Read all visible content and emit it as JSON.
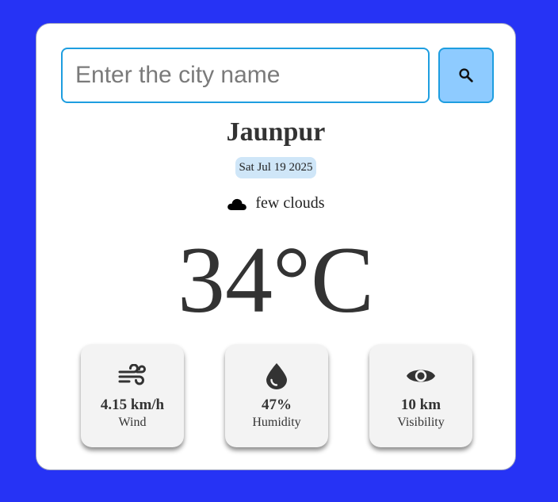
{
  "search": {
    "placeholder": "Enter the city name",
    "value": "",
    "button_icon": "search-icon"
  },
  "weather": {
    "city": "Jaunpur",
    "date": "Sat Jul 19 2025",
    "condition_icon": "cloud-icon",
    "condition": "few clouds",
    "temperature": "34°C"
  },
  "stats": [
    {
      "icon": "wind-icon",
      "value": "4.15 km/h",
      "label": "Wind"
    },
    {
      "icon": "humidity-icon",
      "value": "47%",
      "label": "Humidity"
    },
    {
      "icon": "eye-icon",
      "value": "10 km",
      "label": "Visibility"
    }
  ],
  "colors": {
    "background": "#2633f5",
    "card": "#ffffff",
    "search_button": "#8ecbff",
    "input_border": "#1e9ee0",
    "date_badge": "#cfe6f8",
    "stat_tile": "#f3f3f3"
  }
}
